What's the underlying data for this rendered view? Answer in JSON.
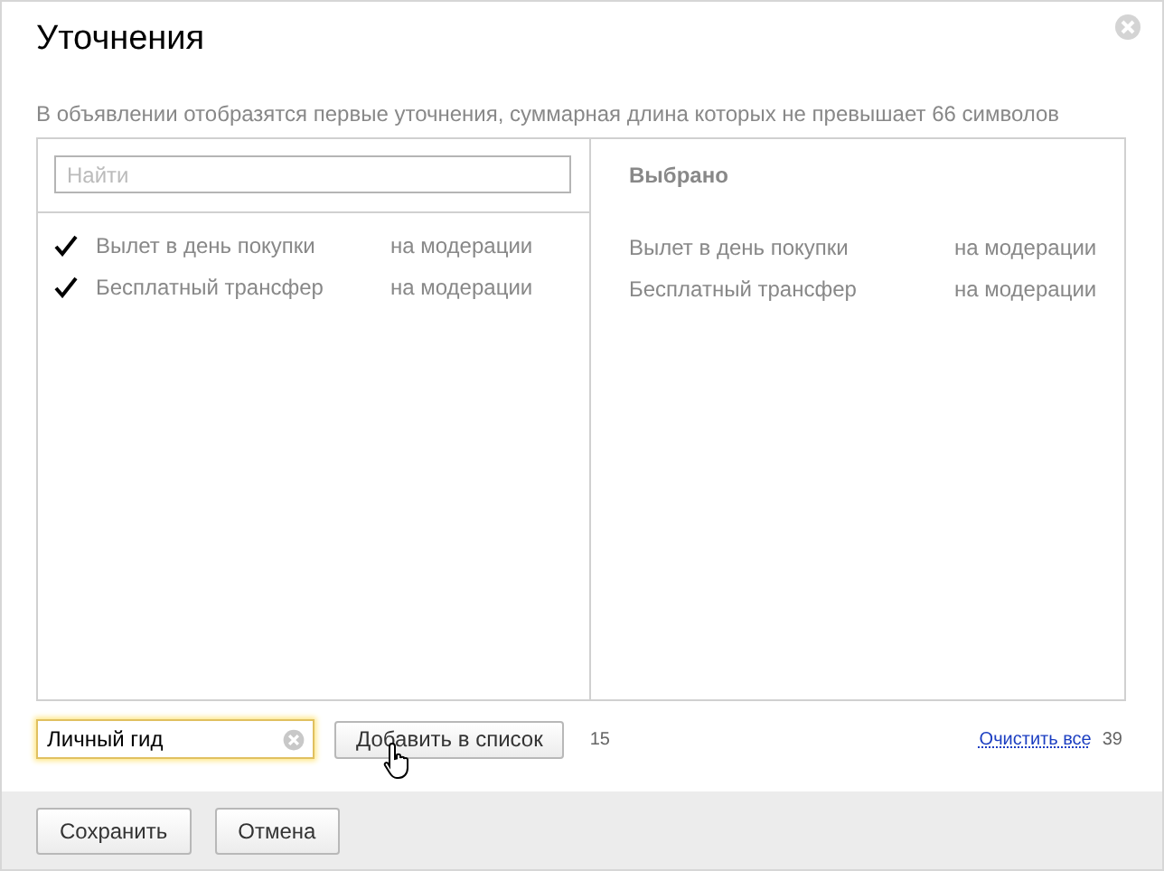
{
  "dialog": {
    "title": "Уточнения",
    "description": "В объявлении отобразятся первые уточнения, суммарная длина которых не превышает 66 символов"
  },
  "available": {
    "search": {
      "placeholder": "Найти"
    },
    "items": [
      {
        "text": "Вылет в день покупки",
        "status": "на модерации",
        "checked": true
      },
      {
        "text": "Бесплатный трансфер",
        "status": "на модерации",
        "checked": true
      }
    ]
  },
  "selected": {
    "heading": "Выбрано",
    "items": [
      {
        "text": "Вылет в день покупки",
        "status": "на модерации"
      },
      {
        "text": "Бесплатный трансфер",
        "status": "на модерации"
      }
    ]
  },
  "add_row": {
    "input": {
      "value": "Личный гид"
    },
    "add_button": "Добавить в список",
    "remaining": "15",
    "clear_link": "Очистить все",
    "total": "39"
  },
  "footer": {
    "buttons": [
      "Сохранить",
      "Отмена"
    ]
  }
}
